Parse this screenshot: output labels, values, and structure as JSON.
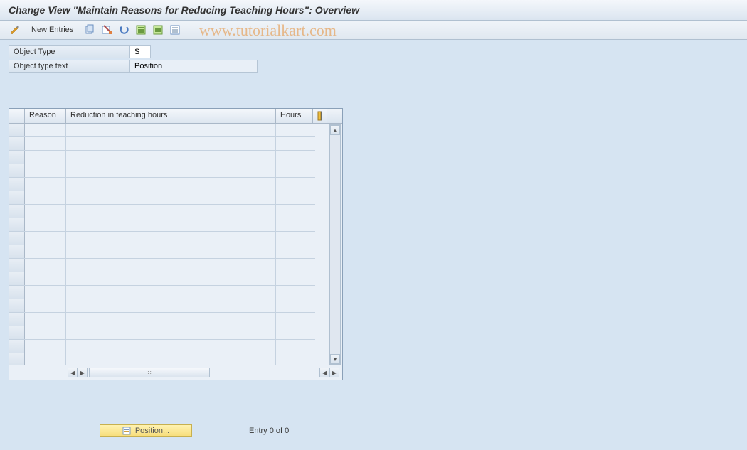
{
  "title": "Change View \"Maintain Reasons for Reducing Teaching Hours\": Overview",
  "toolbar": {
    "new_entries_label": "New Entries"
  },
  "fields": {
    "object_type_label": "Object Type",
    "object_type_value": "S",
    "object_type_text_label": "Object type text",
    "object_type_text_value": "Position"
  },
  "table": {
    "columns": {
      "reason": "Reason",
      "reduction": "Reduction in teaching hours",
      "hours": "Hours"
    },
    "row_count": 18
  },
  "footer": {
    "position_button": "Position...",
    "entry_status": "Entry 0 of 0"
  },
  "watermark": "www.tutorialkart.com"
}
